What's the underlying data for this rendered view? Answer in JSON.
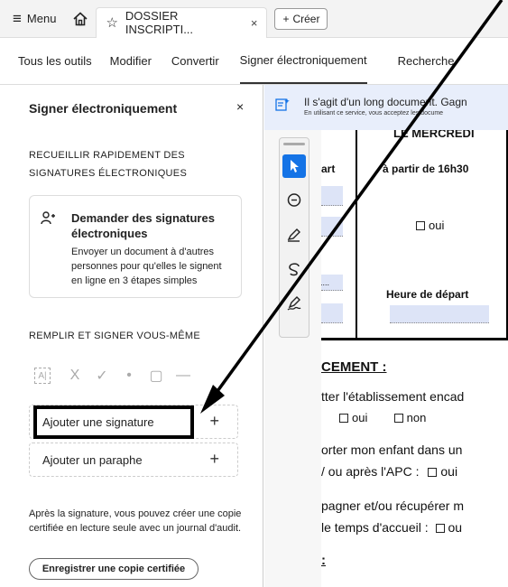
{
  "topbar": {
    "menu_label": "Menu",
    "tab_title": "DOSSIER INSCRIPTI...",
    "tab_close": "×",
    "create_label": "Créer"
  },
  "toolbar": {
    "items": [
      "Tous les outils",
      "Modifier",
      "Convertir",
      "Signer électroniquement",
      "Recherche"
    ],
    "active_index": 3
  },
  "panel": {
    "title": "Signer électroniquement",
    "close": "×",
    "section1": "RECUEILLIR RAPIDEMENT DES SIGNATURES ÉLECTRONIQUES",
    "card_title": "Demander des signatures électroniques",
    "card_desc": "Envoyer un document à d'autres personnes pour qu'elles le signent en ligne en 3 étapes simples",
    "section2": "REMPLIR ET SIGNER VOUS-MÊME",
    "tools": [
      "A|",
      "X",
      "✓",
      "•",
      "▢",
      "—"
    ],
    "add_signature": "Ajouter une signature",
    "add_initials": "Ajouter un paraphe",
    "plus": "+",
    "footnote": "Après la signature, vous pouvez créer une copie certifiée en lecture seule avec un journal d'audit.",
    "certified_button": "Enregistrer une copie certifiée"
  },
  "document": {
    "banner_main": "Il s'agit d'un long document. Gagn",
    "banner_sub": "En utilisant ce service, vous acceptez les docume",
    "day_header": "LE MERCREDI",
    "col_part": "art",
    "col_time": "à partir de 16h30",
    "yes": "oui",
    "no": "non",
    "dots": "......",
    "departure_time": "Heure de départ",
    "heading": "CEMENT :",
    "line1": "tter l'établissement encad",
    "line2": "orter mon enfant dans un",
    "line3": "/ ou après l'APC :",
    "line4": "pagner et/ou récupérer m",
    "line5": "le temps d'accueil :",
    "line5_tail": "ou",
    "heading2": ":",
    "colors": {
      "accent": "#1473e6",
      "field": "#dde4f7"
    }
  }
}
